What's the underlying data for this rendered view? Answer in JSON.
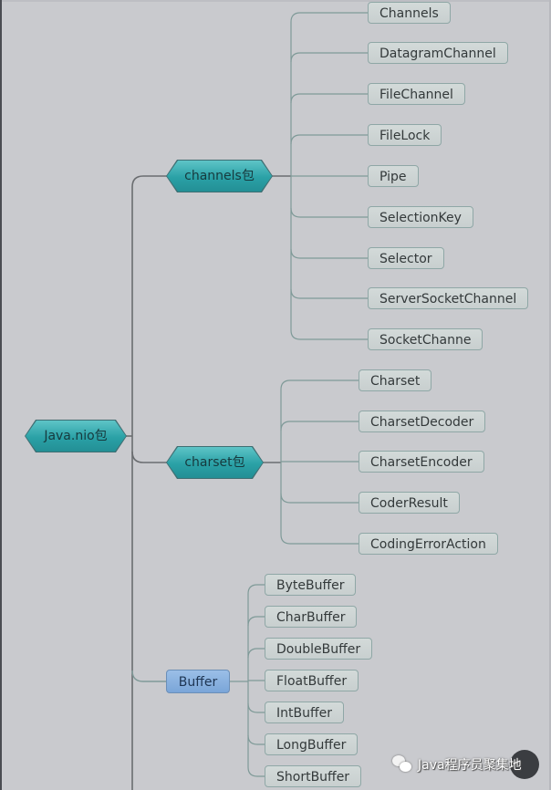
{
  "diagram": {
    "type": "mind-map",
    "root": {
      "label": "Java.nio包"
    },
    "branches": [
      {
        "id": "channels",
        "label": "channels包",
        "style": "hexagon",
        "children": [
          "Channels",
          "DatagramChannel",
          "FileChannel",
          "FileLock",
          "Pipe",
          "SelectionKey",
          "Selector",
          "ServerSocketChannel",
          "SocketChanne"
        ]
      },
      {
        "id": "charset",
        "label": "charset包",
        "style": "hexagon",
        "children": [
          "Charset",
          "CharsetDecoder",
          "CharsetEncoder",
          "CoderResult",
          "CodingErrorAction"
        ]
      },
      {
        "id": "buffer",
        "label": "Buffer",
        "style": "rounded-rect",
        "children": [
          "ByteBuffer",
          "CharBuffer",
          "DoubleBuffer",
          "FloatBuffer",
          "IntBuffer",
          "LongBuffer",
          "ShortBuffer"
        ]
      }
    ]
  },
  "colors": {
    "background": "#c9cace",
    "hex_fill": "#2aa1a6",
    "leaf_fill": "#cdd4d4",
    "leaf_border": "#8fa7a6",
    "buffer_fill": "#8ab2e0",
    "connector": "#6f7a7b"
  },
  "watermark": {
    "icon": "wechat-icon",
    "text": "Java程序员聚集地"
  }
}
